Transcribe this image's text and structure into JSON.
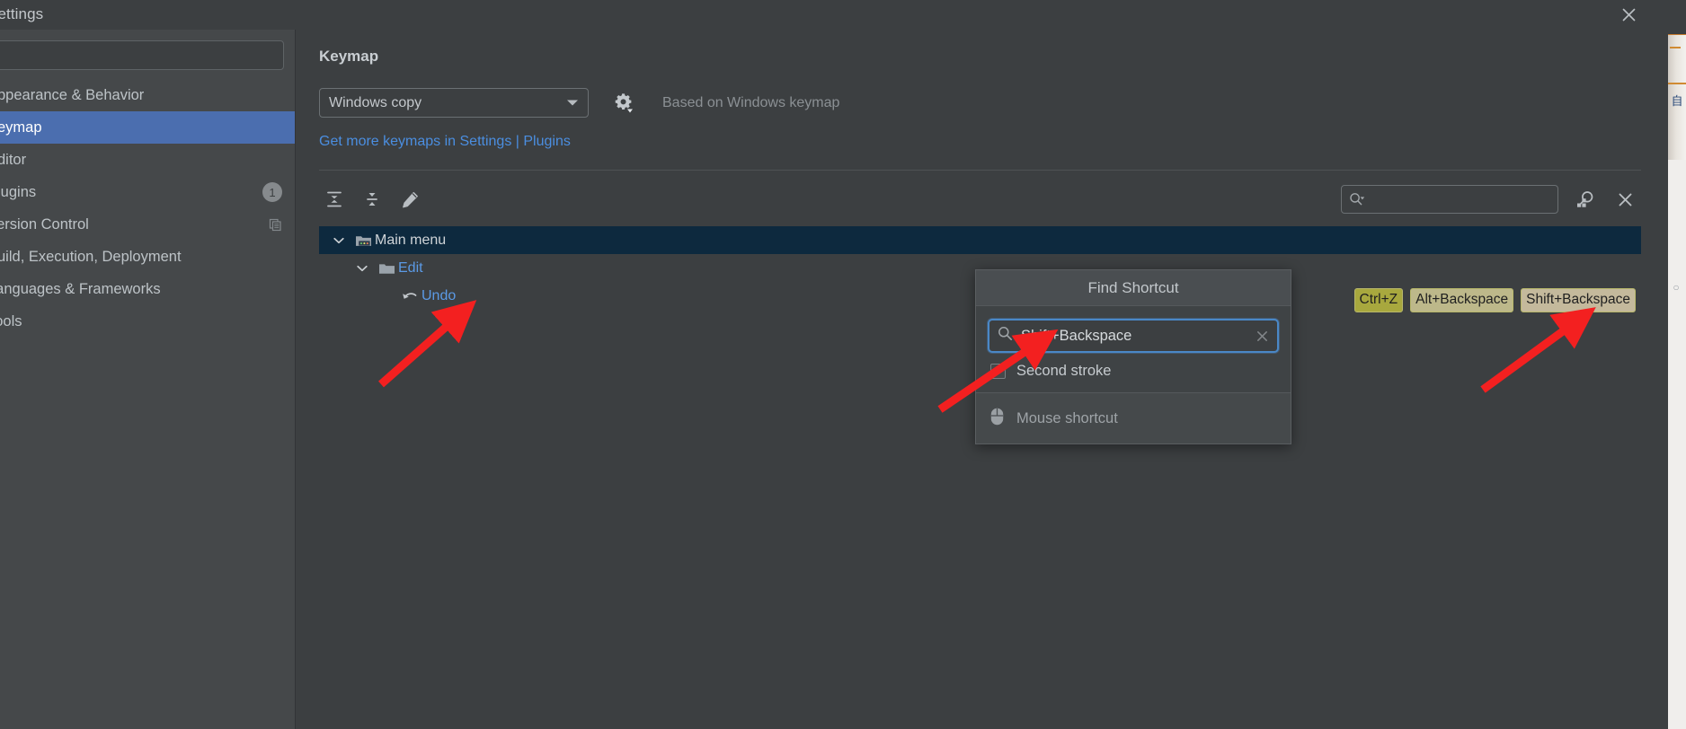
{
  "window": {
    "title": "Settings",
    "close_icon": "close-icon"
  },
  "sidebar": {
    "search_placeholder": "",
    "search_value": "",
    "items": [
      {
        "label": "Appearance & Behavior",
        "selected": false,
        "badge": null,
        "trailing_icon": null
      },
      {
        "label": "Keymap",
        "selected": true,
        "badge": null,
        "trailing_icon": null
      },
      {
        "label": "Editor",
        "selected": false,
        "badge": null,
        "trailing_icon": null
      },
      {
        "label": "Plugins",
        "selected": false,
        "badge": "1",
        "trailing_icon": null
      },
      {
        "label": "Version Control",
        "selected": false,
        "badge": null,
        "trailing_icon": "copy-icon"
      },
      {
        "label": "Build, Execution, Deployment",
        "selected": false,
        "badge": null,
        "trailing_icon": null
      },
      {
        "label": "Languages & Frameworks",
        "selected": false,
        "badge": null,
        "trailing_icon": null
      },
      {
        "label": "Tools",
        "selected": false,
        "badge": null,
        "trailing_icon": null
      }
    ]
  },
  "keymap_page": {
    "title": "Keymap",
    "selected_keymap": "Windows copy",
    "keymap_options": [
      "Windows copy"
    ],
    "gear_icon": "gear-icon",
    "based_on_text": "Based on Windows keymap",
    "more_keymaps_link": "Get more keymaps in Settings | Plugins"
  },
  "toolbar": {
    "expand_all_icon": "expand-all-icon",
    "collapse_all_icon": "collapse-all-icon",
    "edit_icon": "edit-pencil-icon",
    "search_value": "",
    "search_placeholder": "",
    "search_icon": "search-dropdown-icon",
    "find_by_shortcut_icon": "find-by-shortcut-icon",
    "close_icon": "close-icon"
  },
  "tree": {
    "rows": [
      {
        "label": "Main menu",
        "depth": 0,
        "expanded": true,
        "selected": true,
        "icon": "main-menu-folder-icon",
        "style": "plain"
      },
      {
        "label": "Edit",
        "depth": 1,
        "expanded": true,
        "selected": false,
        "icon": "folder-icon",
        "style": "link"
      },
      {
        "label": "Undo",
        "depth": 2,
        "expanded": null,
        "selected": false,
        "icon": "undo-arrow-icon",
        "style": "link"
      }
    ],
    "shortcuts": [
      {
        "text": "Ctrl+Z",
        "variant": "normal"
      },
      {
        "text": "Alt+Backspace",
        "variant": "dim"
      },
      {
        "text": "Shift+Backspace",
        "variant": "highlight"
      }
    ]
  },
  "find_shortcut_popup": {
    "title": "Find Shortcut",
    "input_value": "Shift+Backspace",
    "input_placeholder": "",
    "search_icon": "search-icon",
    "clear_icon": "clear-x-icon",
    "second_stroke_label": "Second stroke",
    "second_stroke_checked": false,
    "mouse_shortcut_label": "Mouse shortcut",
    "mouse_icon": "mouse-icon"
  },
  "annotations": {
    "arrow_color": "#f32020",
    "arrows": [
      {
        "name": "arrow-to-undo"
      },
      {
        "name": "arrow-to-find-shortcut-input"
      },
      {
        "name": "arrow-to-shift-backspace-badge"
      }
    ]
  },
  "colors": {
    "accent_blue": "#4b6eaf",
    "link_blue": "#4b8ee0",
    "panel_bg": "#3c3f41",
    "sidebar_bg": "#45484a",
    "selection_tree": "#0d293e",
    "shortcut_badge": "#a8a83e",
    "arrow_red": "#f32020"
  }
}
